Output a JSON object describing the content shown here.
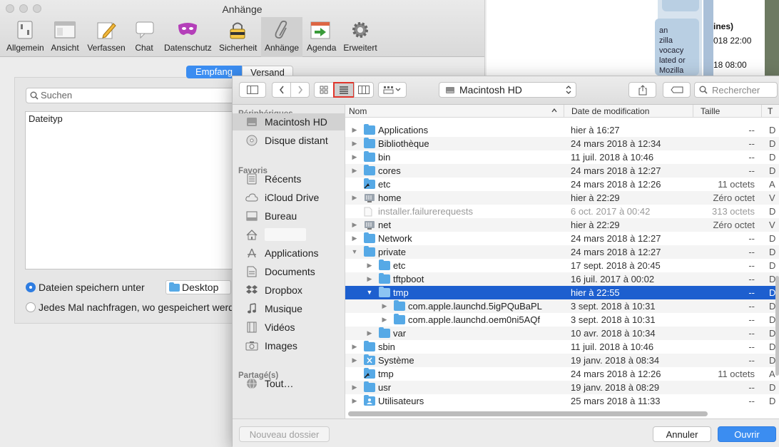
{
  "background": {
    "card_lines": [
      "an",
      "zilla",
      "vocacy",
      "lated or",
      "Mozilla"
    ],
    "right_texts": [
      "ines)",
      "018 22:00",
      "18 08:00"
    ]
  },
  "prefs": {
    "title": "Anhänge",
    "toolbar": [
      {
        "label": "Allgemein",
        "icon": "switch-icon"
      },
      {
        "label": "Ansicht",
        "icon": "window-icon"
      },
      {
        "label": "Verfassen",
        "icon": "pencil-icon"
      },
      {
        "label": "Chat",
        "icon": "speech-bubble-icon"
      },
      {
        "label": "Datenschutz",
        "icon": "mask-icon"
      },
      {
        "label": "Sicherheit",
        "icon": "padlock-icon"
      },
      {
        "label": "Anhänge",
        "icon": "paperclip-icon"
      },
      {
        "label": "Agenda",
        "icon": "calendar-icon"
      },
      {
        "label": "Erweitert",
        "icon": "gear-icon"
      }
    ],
    "segments": {
      "left": "Empfang",
      "right": "Versand"
    },
    "search_placeholder": "Suchen",
    "type_header": "Dateityp",
    "radio_save": "Dateien speichern unter",
    "save_target": "Desktop",
    "radio_ask": "Jedes Mal nachfragen, wo gespeichert werd"
  },
  "finder": {
    "location": "Macintosh HD",
    "search_placeholder": "Rechercher",
    "sidebar": {
      "sections": [
        {
          "title": "Périphériques",
          "items": [
            {
              "label": "Macintosh HD",
              "icon": "hard-drive-icon",
              "selected": true
            },
            {
              "label": "Disque distant",
              "icon": "disc-icon"
            }
          ]
        },
        {
          "title": "Favoris",
          "items": [
            {
              "label": "Récents",
              "icon": "recents-icon"
            },
            {
              "label": "iCloud Drive",
              "icon": "cloud-icon"
            },
            {
              "label": "Bureau",
              "icon": "desktop-icon"
            },
            {
              "label": "",
              "icon": "home-icon"
            },
            {
              "label": "Applications",
              "icon": "applications-icon"
            },
            {
              "label": "Documents",
              "icon": "documents-icon"
            },
            {
              "label": "Dropbox",
              "icon": "dropbox-icon"
            },
            {
              "label": "Musique",
              "icon": "music-icon"
            },
            {
              "label": "Vidéos",
              "icon": "film-icon"
            },
            {
              "label": "Images",
              "icon": "camera-icon"
            }
          ]
        },
        {
          "title": "Partagé(s)",
          "items": [
            {
              "label": "Tout…",
              "icon": "network-icon"
            }
          ]
        }
      ]
    },
    "columns": {
      "name": "Nom",
      "date": "Date de modification",
      "size": "Taille",
      "kind": "T"
    },
    "rows": [
      {
        "name": "Applications",
        "date": "hier à 16:27",
        "size": "--",
        "kind": "D",
        "level": 0,
        "disc": "closed",
        "icon": "folder"
      },
      {
        "name": "Bibliothèque",
        "date": "24 mars 2018 à 12:34",
        "size": "--",
        "kind": "D",
        "level": 0,
        "disc": "closed",
        "icon": "folder"
      },
      {
        "name": "bin",
        "date": "11 juil. 2018 à 10:46",
        "size": "--",
        "kind": "D",
        "level": 0,
        "disc": "closed",
        "icon": "folder"
      },
      {
        "name": "cores",
        "date": "24 mars 2018 à 12:27",
        "size": "--",
        "kind": "D",
        "level": 0,
        "disc": "closed",
        "icon": "folder"
      },
      {
        "name": "etc",
        "date": "24 mars 2018 à 12:26",
        "size": "11 octets",
        "kind": "A",
        "level": 0,
        "disc": "none",
        "icon": "alias"
      },
      {
        "name": "home",
        "date": "hier à 22:29",
        "size": "Zéro octet",
        "kind": "V",
        "level": 0,
        "disc": "closed",
        "icon": "server"
      },
      {
        "name": "installer.failurerequests",
        "date": "6 oct. 2017 à 00:42",
        "size": "313 octets",
        "kind": "D",
        "level": 0,
        "disc": "none",
        "icon": "file",
        "dim": true
      },
      {
        "name": "net",
        "date": "hier à 22:29",
        "size": "Zéro octet",
        "kind": "V",
        "level": 0,
        "disc": "closed",
        "icon": "server"
      },
      {
        "name": "Network",
        "date": "24 mars 2018 à 12:27",
        "size": "--",
        "kind": "D",
        "level": 0,
        "disc": "closed",
        "icon": "folder"
      },
      {
        "name": "private",
        "date": "24 mars 2018 à 12:27",
        "size": "--",
        "kind": "D",
        "level": 0,
        "disc": "open",
        "icon": "folder"
      },
      {
        "name": "etc",
        "date": "17 sept. 2018 à 20:45",
        "size": "--",
        "kind": "D",
        "level": 1,
        "disc": "closed",
        "icon": "folder"
      },
      {
        "name": "tftpboot",
        "date": "16 juil. 2017 à 00:02",
        "size": "--",
        "kind": "D",
        "level": 1,
        "disc": "closed",
        "icon": "folder"
      },
      {
        "name": "tmp",
        "date": "hier à 22:55",
        "size": "--",
        "kind": "D",
        "level": 1,
        "disc": "open",
        "icon": "folder",
        "selected": true
      },
      {
        "name": "com.apple.launchd.5igPQuBaPL",
        "date": "3 sept. 2018 à 10:31",
        "size": "--",
        "kind": "D",
        "level": 2,
        "disc": "closed",
        "icon": "folder"
      },
      {
        "name": "com.apple.launchd.oem0ni5AQf",
        "date": "3 sept. 2018 à 10:31",
        "size": "--",
        "kind": "D",
        "level": 2,
        "disc": "closed",
        "icon": "folder"
      },
      {
        "name": "var",
        "date": "10 avr. 2018 à 10:34",
        "size": "--",
        "kind": "D",
        "level": 1,
        "disc": "closed",
        "icon": "folder"
      },
      {
        "name": "sbin",
        "date": "11 juil. 2018 à 10:46",
        "size": "--",
        "kind": "D",
        "level": 0,
        "disc": "closed",
        "icon": "folder"
      },
      {
        "name": "Système",
        "date": "19 janv. 2018 à 08:34",
        "size": "--",
        "kind": "D",
        "level": 0,
        "disc": "closed",
        "icon": "folder-x"
      },
      {
        "name": "tmp",
        "date": "24 mars 2018 à 12:26",
        "size": "11 octets",
        "kind": "A",
        "level": 0,
        "disc": "none",
        "icon": "alias"
      },
      {
        "name": "usr",
        "date": "19 janv. 2018 à 08:29",
        "size": "--",
        "kind": "D",
        "level": 0,
        "disc": "closed",
        "icon": "folder"
      },
      {
        "name": "Utilisateurs",
        "date": "25 mars 2018 à 11:33",
        "size": "--",
        "kind": "D",
        "level": 0,
        "disc": "closed",
        "icon": "folder-users"
      }
    ],
    "buttons": {
      "new_folder": "Nouveau dossier",
      "cancel": "Annuler",
      "open": "Ouvrir"
    },
    "colors": {
      "accent": "#1d5fcf",
      "folder": "#56a9e6",
      "highlight": "#e0352b"
    }
  }
}
